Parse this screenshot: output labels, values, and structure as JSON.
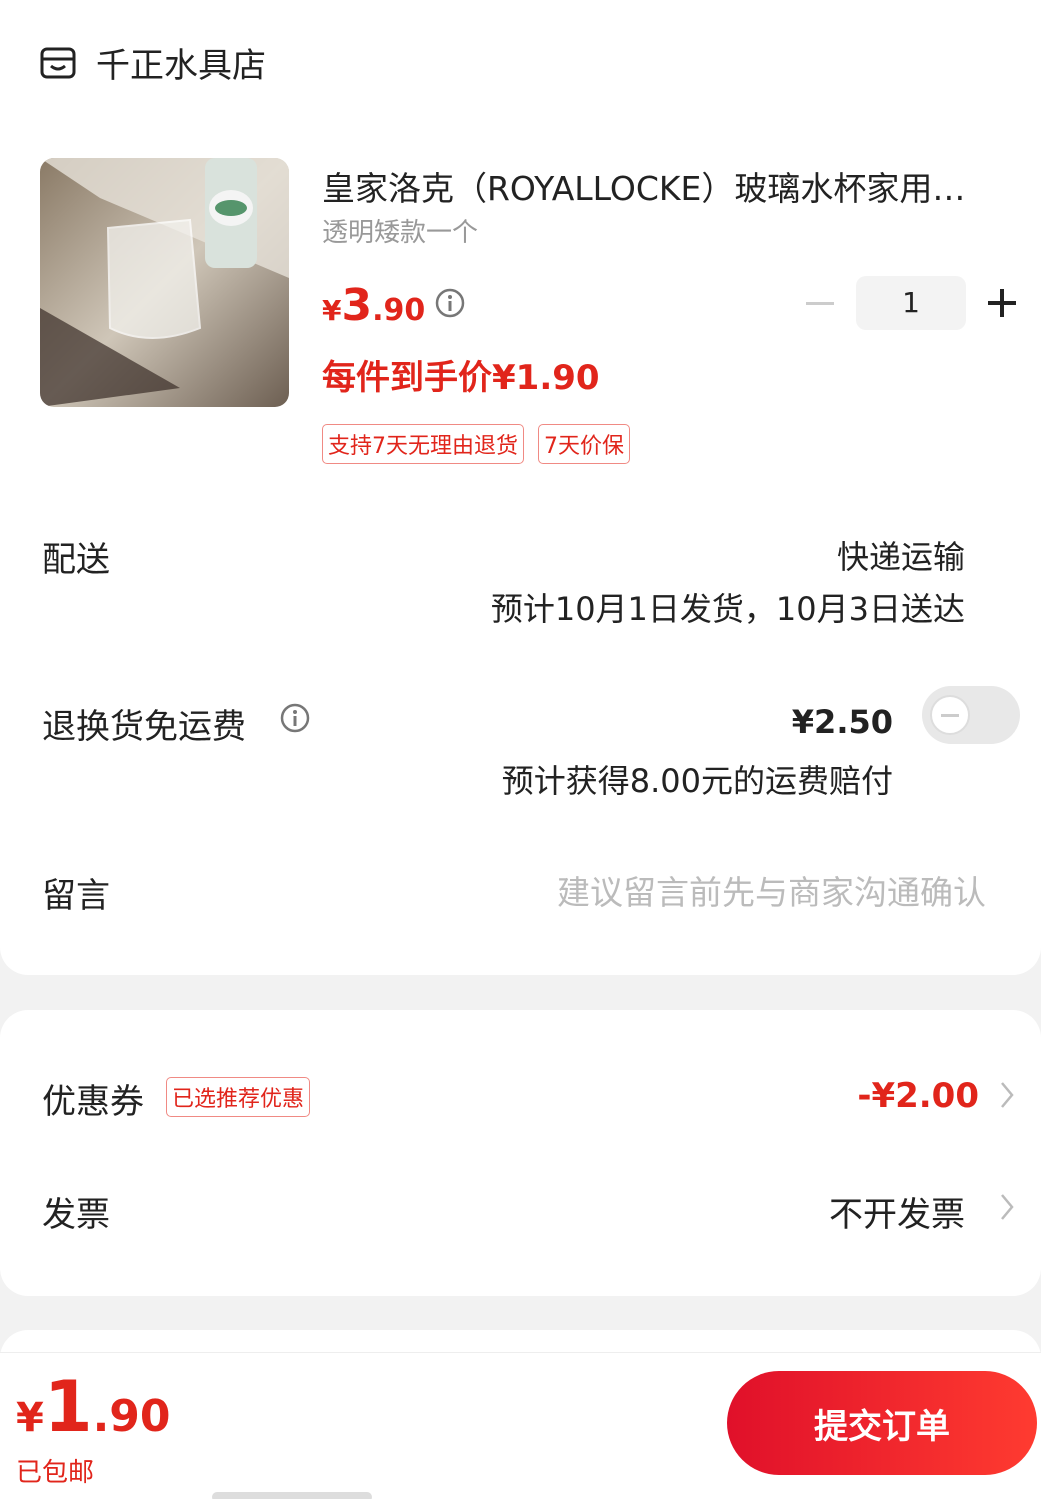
{
  "store": {
    "name": "千正水具店",
    "icon": "store-icon"
  },
  "product": {
    "title": "皇家洛克（ROYALLOCKE）玻璃水杯家用…",
    "sku": "透明矮款一个",
    "price_currency": "¥",
    "price_int": "3",
    "price_dec": ".90",
    "deal_price": "每件到手价¥1.90",
    "quantity": "1",
    "tags": [
      "支持7天无理由退货",
      "7天价保"
    ]
  },
  "delivery": {
    "label": "配送",
    "method": "快递运输",
    "estimate": "预计10月1日发货，10月3日送达"
  },
  "return_shipping": {
    "label": "退换货免运费",
    "price": "¥2.50",
    "compensation": "预计获得8.00元的运费赔付",
    "enabled": false
  },
  "message": {
    "label": "留言",
    "placeholder": "建议留言前先与商家沟通确认"
  },
  "coupon": {
    "label": "优惠券",
    "tag": "已选推荐优惠",
    "value": "-¥2.00"
  },
  "invoice": {
    "label": "发票",
    "value": "不开发票"
  },
  "footer": {
    "total_currency": "¥",
    "total_int": "1",
    "total_dec": ".90",
    "shipping_note": "已包邮",
    "submit_label": "提交订单"
  },
  "colors": {
    "accent": "#e1251b",
    "background": "#f2f2f2"
  }
}
